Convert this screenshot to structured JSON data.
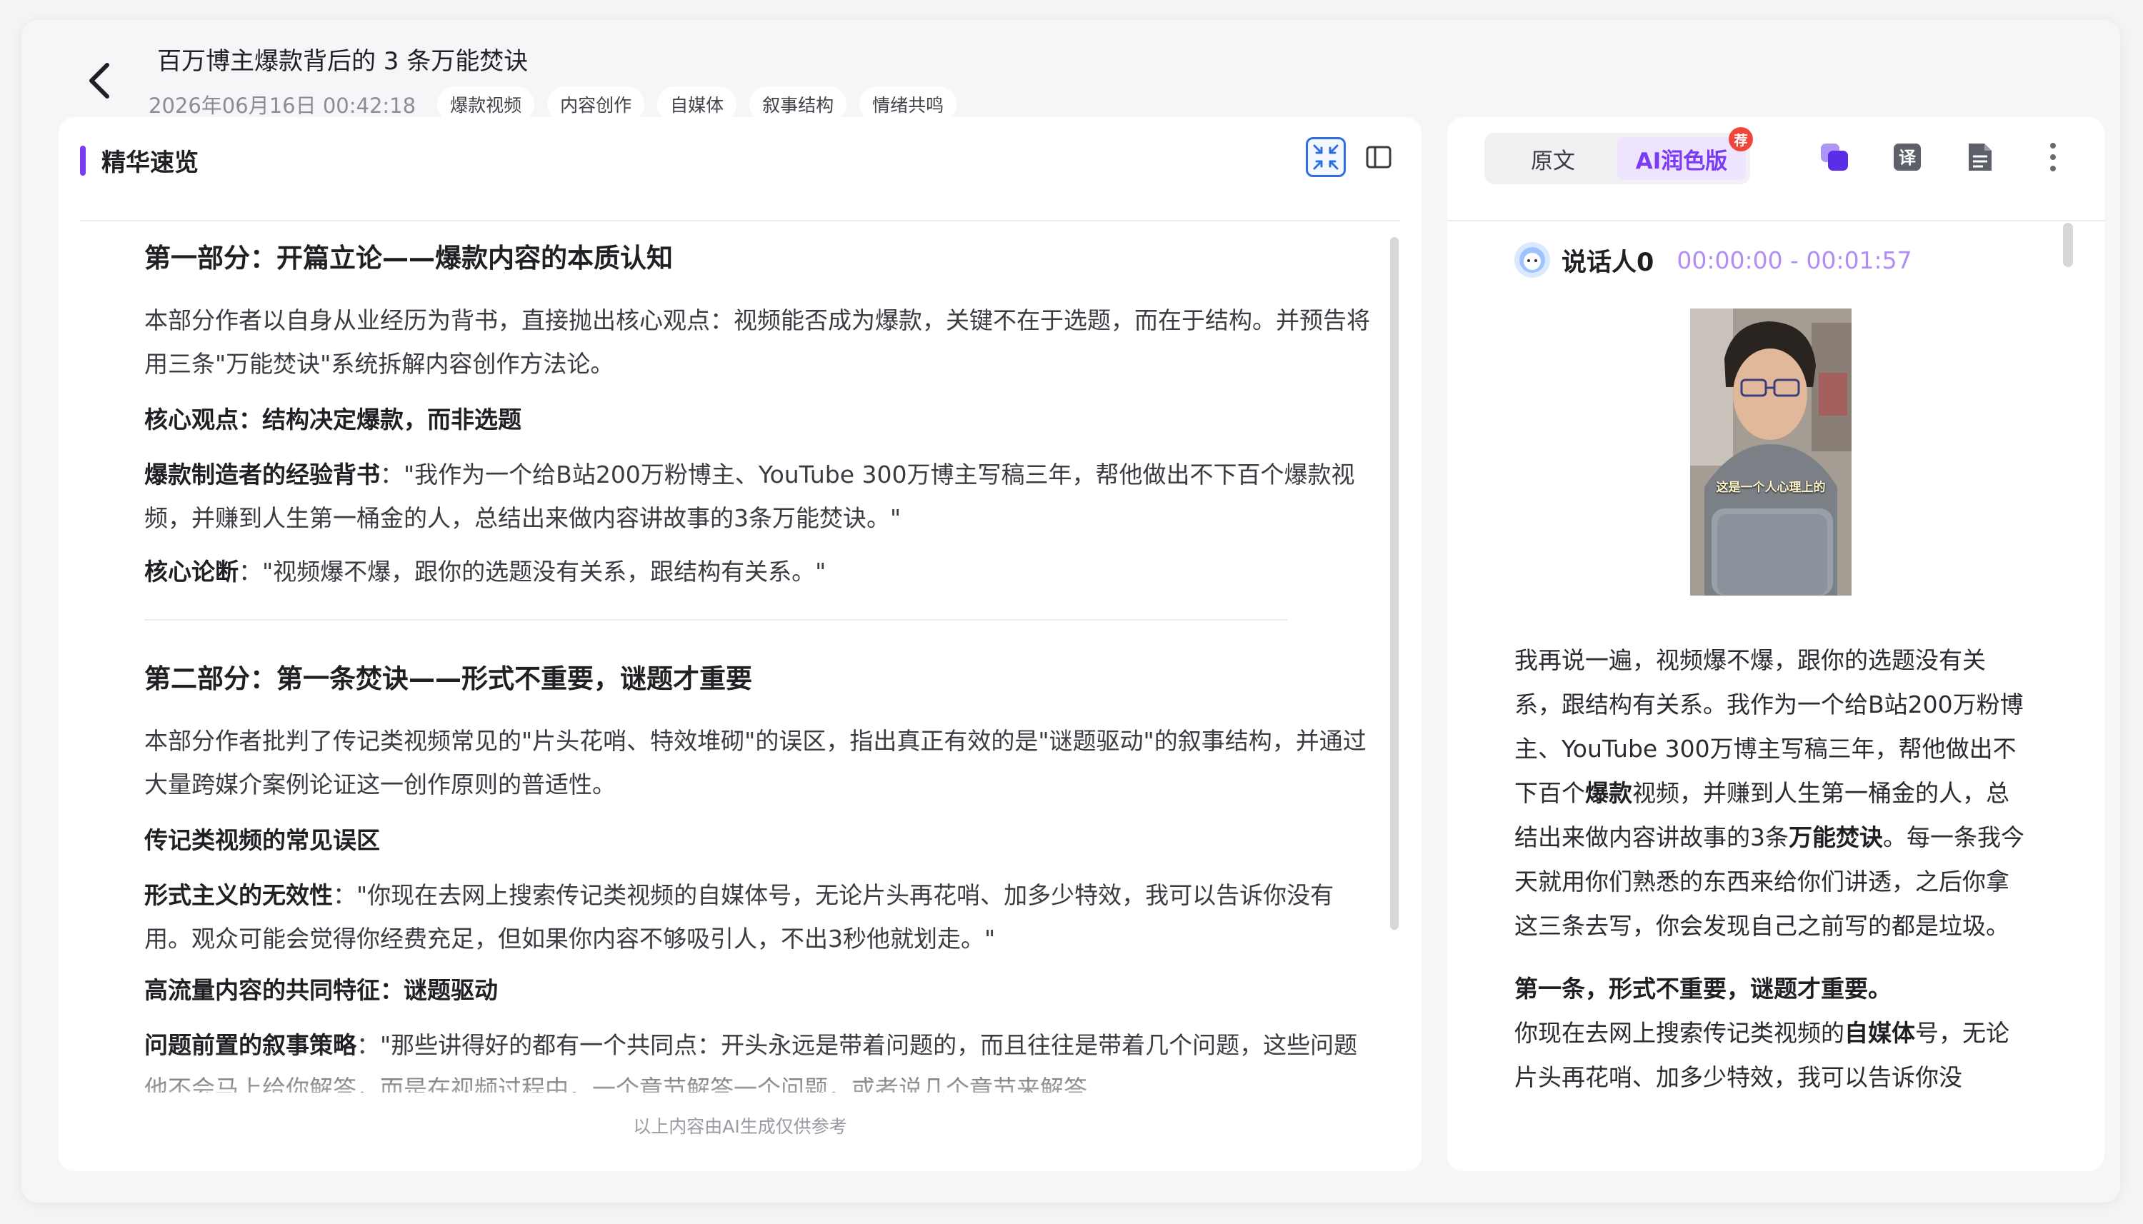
{
  "header": {
    "title": "百万博主爆款背后的 3 条万能焚诀",
    "date": "2026年06月16日 00:42:18",
    "tags": [
      "爆款视频",
      "内容创作",
      "自媒体",
      "叙事结构",
      "情绪共鸣"
    ]
  },
  "summary_panel": {
    "title": "精华速览",
    "footer_note": "以上内容由AI生成仅供参考",
    "sections": [
      {
        "title": "第一部分：开篇立论——爆款内容的本质认知",
        "intro": "本部分作者以自身从业经历为背书，直接抛出核心观点：视频能否成为爆款，关键不在于选题，而在于结构。并预告将用三条\"万能焚诀\"系统拆解内容创作方法论。",
        "subhead": "核心观点：结构决定爆款，而非选题",
        "points": [
          {
            "label": "爆款制造者的经验背书",
            "text": "：\"我作为一个给B站200万粉博主、YouTube 300万博主写稿三年，帮他做出不下百个爆款视频，并赚到人生第一桶金的人，总结出来做内容讲故事的3条万能焚诀。\""
          },
          {
            "label": "核心论断",
            "text": "：\"视频爆不爆，跟你的选题没有关系，跟结构有关系。\""
          }
        ]
      },
      {
        "title": "第二部分：第一条焚诀——形式不重要，谜题才重要",
        "intro": "本部分作者批判了传记类视频常见的\"片头花哨、特效堆砌\"的误区，指出真正有效的是\"谜题驱动\"的叙事结构，并通过大量跨媒介案例论证这一创作原则的普适性。",
        "subhead1": "传记类视频的常见误区",
        "point1": {
          "label": "形式主义的无效性",
          "text": "：\"你现在去网上搜索传记类视频的自媒体号，无论片头再花哨、加多少特效，我可以告诉你没有用。观众可能会觉得你经费充足，但如果你内容不够吸引人，不出3秒他就划走。\""
        },
        "subhead2": "高流量内容的共同特征：谜题驱动",
        "point2": {
          "label": "问题前置的叙事策略",
          "text": "：\"那些讲得好的都有一个共同点：开头永远是带着问题的，而且往往是带着几个问题，这些问题他不会马上给你解答，而是在视频过程中，一个章节解答一个问题，或者说几个章节来解答"
        }
      }
    ]
  },
  "transcript_panel": {
    "tabs": {
      "original": "原文",
      "ai": "AI润色版",
      "badge": "荐"
    },
    "speaker": "说话人0",
    "time_range": "00:00:00 - 00:01:57",
    "video_caption": "这是一个人心理上的",
    "paragraph1": {
      "a": "我再说一遍，视频爆不爆，跟你的选题没有关系，跟结构有关系。我作为一个给B站200万粉博主、YouTube 300万博主写稿三年，帮他做出不下百个",
      "b1": "爆款",
      "c": "视频，并赚到人生第一桶金的人，总结出来做内容讲故事的3条",
      "b2": "万能焚诀",
      "d": "。每一条我今天就用你们熟悉的东西来给你们讲透，之后你拿这三条去写，你会发现自己之前写的都是垃圾。"
    },
    "heading2": "第一条，形式不重要，谜题才重要。",
    "paragraph2": {
      "a": "你现在去网上搜索传记类视频的",
      "b": "自媒体",
      "c": "号，无论片头再花哨、加多少特效，我可以告诉你没"
    }
  }
}
